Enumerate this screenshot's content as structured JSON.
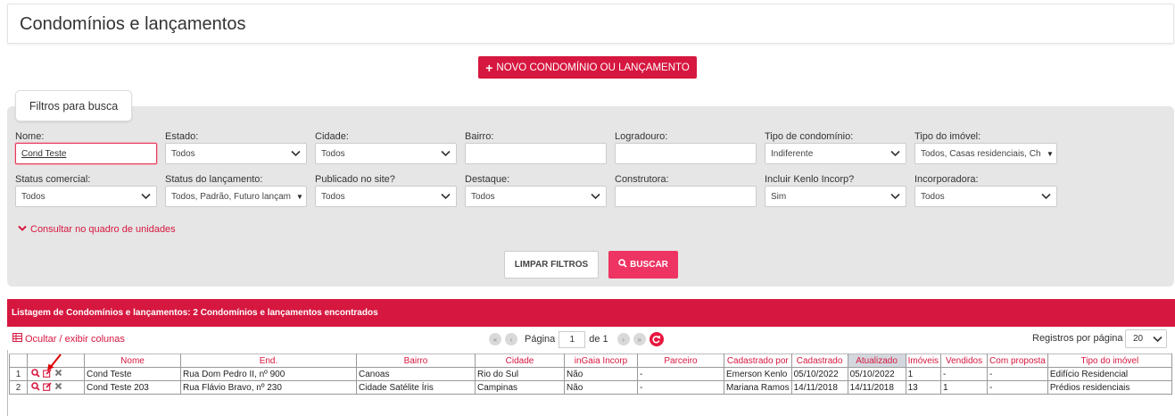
{
  "page": {
    "title": "Condomínios e lançamentos"
  },
  "actions": {
    "new_button": "NOVO CONDOMÍNIO OU LANÇAMENTO"
  },
  "filters": {
    "tab_label": "Filtros para busca",
    "nome": {
      "label": "Nome:",
      "value": "Cond Teste"
    },
    "estado": {
      "label": "Estado:",
      "value": "Todos"
    },
    "cidade": {
      "label": "Cidade:",
      "value": "Todos"
    },
    "bairro": {
      "label": "Bairro:",
      "value": ""
    },
    "logradouro": {
      "label": "Logradouro:",
      "value": ""
    },
    "tipo_condominio": {
      "label": "Tipo de condomínio:",
      "value": "Indiferente"
    },
    "tipo_imovel": {
      "label": "Tipo do imóvel:",
      "value": "Todos, Casas residenciais, Ch"
    },
    "status_comercial": {
      "label": "Status comercial:",
      "value": "Todos"
    },
    "status_lancamento": {
      "label": "Status do lançamento:",
      "value": "Todos, Padrão, Futuro lançam"
    },
    "publicado": {
      "label": "Publicado no site?",
      "value": "Todos"
    },
    "destaque": {
      "label": "Destaque:",
      "value": "Todos"
    },
    "construtora": {
      "label": "Construtora:",
      "value": ""
    },
    "kenlo": {
      "label": "Incluir Kenlo Incorp?",
      "value": "Sim"
    },
    "incorporadora": {
      "label": "Incorporadora:",
      "value": "Todos"
    },
    "consult_link": "Consultar no quadro de unidades",
    "clear_button": "LIMPAR FILTROS",
    "search_button": "BUSCAR"
  },
  "listing": {
    "header": "Listagem de Condomínios e lançamentos: 2 Condomínios e lançamentos encontrados",
    "columns_toggle": "Ocultar / exibir colunas",
    "pager": {
      "page_label": "Página",
      "page": "1",
      "of_label": "de 1"
    },
    "per_page_label": "Registros por página",
    "per_page": "20",
    "columns": [
      "Nome",
      "End.",
      "Bairro",
      "Cidade",
      "inGaia Incorp",
      "Parceiro",
      "Cadastrado por",
      "Cadastrado",
      "Atualizado",
      "Imóveis",
      "Vendidos",
      "Com proposta",
      "Tipo do imóvel"
    ],
    "rows": [
      {
        "n": "1",
        "nome": "Cond Teste",
        "end": "Rua Dom Pedro II, nº 900",
        "bairro": "Canoas",
        "cidade": "Rio do Sul",
        "ingaia": "Não",
        "parceiro": "-",
        "cadastrado_por": "Emerson Kenlo",
        "cadastrado": "05/10/2022",
        "atualizado": "05/10/2022",
        "imoveis": "1",
        "vendidos": "-",
        "com_proposta": "-",
        "tipo": "Edifício Residencial"
      },
      {
        "n": "2",
        "nome": "Cond Teste 203",
        "end": "Rua Flávio Bravo, nº 230",
        "bairro": "Cidade Satélite Íris",
        "cidade": "Campinas",
        "ingaia": "Não",
        "parceiro": "-",
        "cadastrado_por": "Mariana Ramos",
        "cadastrado": "14/11/2018",
        "atualizado": "14/11/2018",
        "imoveis": "13",
        "vendidos": "1",
        "com_proposta": "-",
        "tipo": "Prédios residenciais"
      }
    ]
  },
  "colors": {
    "brand": "#d6173f",
    "search": "#ee3463",
    "panel": "#e6e6e6"
  },
  "icons": [
    "plus-icon",
    "chevron-down-icon",
    "search-icon",
    "edit-icon",
    "delete-icon",
    "grid-icon",
    "refresh-icon",
    "annotation-arrow"
  ]
}
